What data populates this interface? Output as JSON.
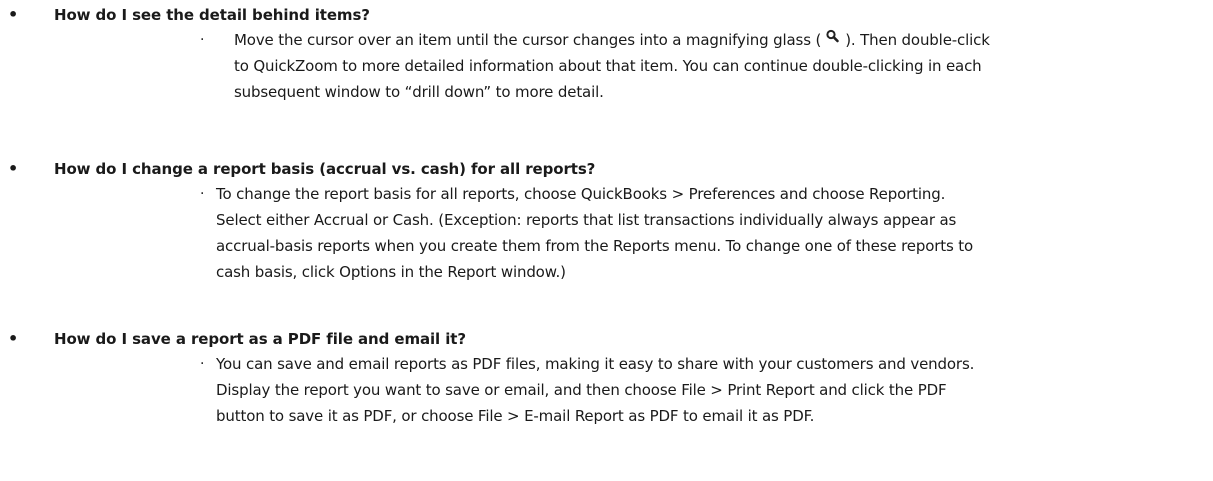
{
  "faq": [
    {
      "question": "How do I see the detail behind items?",
      "answer_lines": [
        "Move the cursor over an item until the cursor changes into a magnifying glass (",
        "). Then double-click",
        "to QuickZoom to more detailed information about that item. You can continue double-clicking in each",
        "subsequent window to “drill down” to more detail."
      ],
      "icon": "magnifying-glass-icon"
    },
    {
      "question": "How do I change a report basis (accrual vs. cash) for all reports?",
      "answer_lines": [
        "To change the report basis for all reports, choose QuickBooks > Preferences and choose Reporting.",
        "Select either Accrual or Cash. (Exception: reports that list transactions individually always appear as",
        "accrual-basis reports when you create them from the Reports menu. To change one of these reports to",
        "cash basis, click Options in the Report window.)"
      ]
    },
    {
      "question": "How do I save a report as a PDF file and email it?",
      "answer_lines": [
        "You can save and email reports as PDF files, making it easy to share with your customers and vendors.",
        "Display the report you want to save or email, and then choose File > Print Report and click the PDF",
        "button to save it as PDF, or choose File > E-mail Report as PDF to email it as PDF."
      ]
    }
  ],
  "bullets": {
    "question": "•",
    "answer": "·"
  }
}
